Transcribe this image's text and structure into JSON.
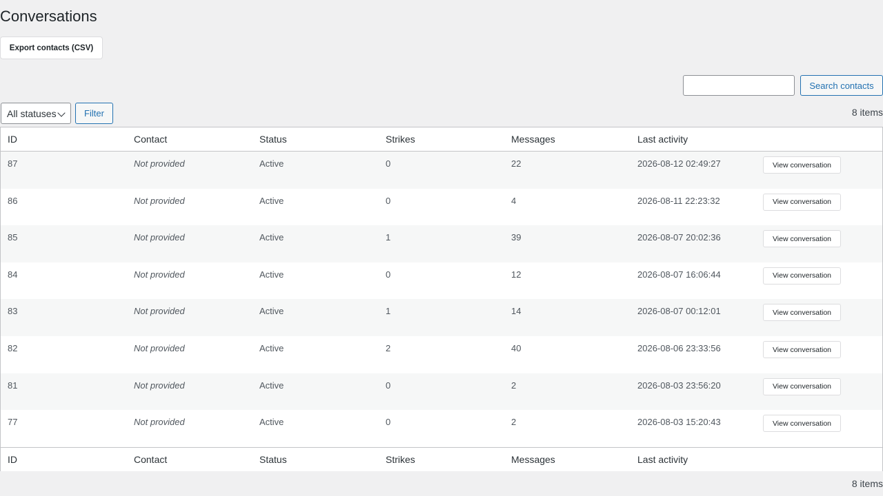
{
  "page": {
    "title": "Conversations",
    "export_label": "Export contacts (CSV)",
    "search_button": "Search contacts",
    "search_value": "",
    "status_filter": "All statuses",
    "filter_label": "Filter",
    "items_count": "8 items"
  },
  "table": {
    "columns": [
      "ID",
      "Contact",
      "Status",
      "Strikes",
      "Messages",
      "Last activity"
    ],
    "action_label": "View conversation",
    "rows": [
      {
        "id": "87",
        "contact": "Not provided",
        "status": "Active",
        "strikes": "0",
        "messages": "22",
        "last_activity": "2026-08-12 02:49:27"
      },
      {
        "id": "86",
        "contact": "Not provided",
        "status": "Active",
        "strikes": "0",
        "messages": "4",
        "last_activity": "2026-08-11 22:23:32"
      },
      {
        "id": "85",
        "contact": "Not provided",
        "status": "Active",
        "strikes": "1",
        "messages": "39",
        "last_activity": "2026-08-07 20:02:36"
      },
      {
        "id": "84",
        "contact": "Not provided",
        "status": "Active",
        "strikes": "0",
        "messages": "12",
        "last_activity": "2026-08-07 16:06:44"
      },
      {
        "id": "83",
        "contact": "Not provided",
        "status": "Active",
        "strikes": "1",
        "messages": "14",
        "last_activity": "2026-08-07 00:12:01"
      },
      {
        "id": "82",
        "contact": "Not provided",
        "status": "Active",
        "strikes": "2",
        "messages": "40",
        "last_activity": "2026-08-06 23:33:56"
      },
      {
        "id": "81",
        "contact": "Not provided",
        "status": "Active",
        "strikes": "0",
        "messages": "2",
        "last_activity": "2026-08-03 23:56:20"
      },
      {
        "id": "77",
        "contact": "Not provided",
        "status": "Active",
        "strikes": "0",
        "messages": "2",
        "last_activity": "2026-08-03 15:20:43"
      }
    ]
  }
}
